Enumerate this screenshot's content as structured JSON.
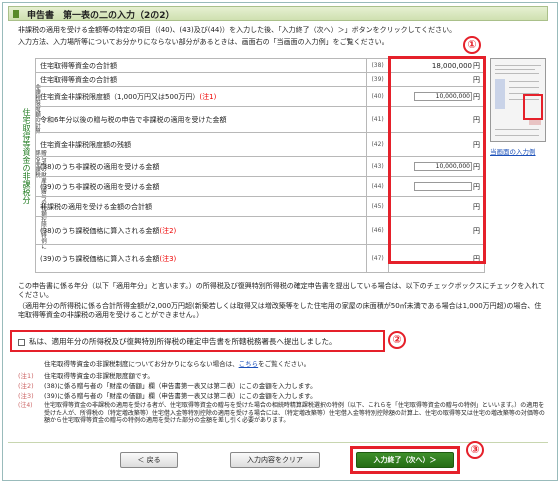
{
  "page": {
    "title": "申告書　第一表の二の入力（2の2）",
    "intro_lines": [
      "非課税の適用を受ける金額等の特定の項目（(40)、(43)及び(44)）を入力した後、「入力終了（次へ）＞」ボタンをクリックしてください。",
      "入力方法、入力場所等についてお分かりにならない部分があるときは、画面右の「当画面の入力例」をご覧ください。"
    ]
  },
  "annotations": [
    "①",
    "②",
    "③"
  ],
  "side_label": "住宅取得等資金の非課税分",
  "side_sublabels": [
    "非課税限度額の計算",
    "贈与者の財産の贈与の税額控除の特例に係る非課税"
  ],
  "rows": [
    {
      "label": "住宅取得等資金の合計額",
      "num": "(38)",
      "value": "18,000,000",
      "unit": "円"
    },
    {
      "label": "住宅取得等資金の合計額",
      "num": "(39)",
      "value": "",
      "unit": "円"
    },
    {
      "label": "住宅資金非課税限度額（1,000万円又は500万円）",
      "note": "(注1)",
      "num": "(40)",
      "input": "10,000,000",
      "unit": "円"
    },
    {
      "label": "令和6年分以後の贈与税の申告で非課税の適用を受けた金額",
      "num": "(41)",
      "value": "",
      "unit": "円"
    },
    {
      "label": "住宅資金非課税限度額の残額",
      "num": "(42)",
      "value": "",
      "unit": "円"
    },
    {
      "label": "(38)のうち非課税の適用を受ける金額",
      "num": "(43)",
      "input": "10,000,000",
      "unit": "円"
    },
    {
      "label": "(39)のうち非課税の適用を受ける金額",
      "num": "(44)",
      "input": "",
      "unit": "円"
    },
    {
      "label": "非課税の適用を受ける金額の合計額",
      "num": "(45)",
      "value": "",
      "unit": "円"
    },
    {
      "label": "(38)のうち課税価格に算入される金額",
      "note": "(注2)",
      "num": "(46)",
      "value": "",
      "unit": "円"
    },
    {
      "label": "(39)のうち課税価格に算入される金額",
      "note": "(注3)",
      "num": "(47)",
      "value": "",
      "unit": "円"
    }
  ],
  "thumb_link": "当画面の入力例",
  "para1": "この申告書に係る年分（以下「適用年分」と言います。）の所得税及び復興特別所得税の確定申告書を提出している場合は、以下のチェックボックスにチェックを入れてください。",
  "para2": "（適用年分の所得税に係る合計所得金額が2,000万円超(新築若しくは取得又は増改築等をした住宅用の家屋の床面積が50㎡未満である場合は1,000万円超)の場合、住宅取得等資金の非課税の適用を受けることができません。）",
  "checkbox_label": "私は、適用年分の所得税及び復興特別所得税の確定申告書を所轄税務署長へ提出しました。",
  "notes": [
    {
      "key": "",
      "text": "住宅取得等資金の非課税制度についてお分かりにならない場合は、",
      "link": "こちら",
      "tail": "をご覧ください。"
    },
    {
      "key": "(注1)",
      "text": "住宅取得等資金の非課税限度額です。"
    },
    {
      "key": "(注2)",
      "text": "(38)に係る贈与者の「財産の価額」欄（申告書第一表又は第二表）にこの金額を入力します。"
    },
    {
      "key": "(注3)",
      "text": "(39)に係る贈与者の「財産の価額」欄（申告書第一表又は第二表）にこの金額を入力します。"
    },
    {
      "key": "(注4)",
      "text": "住宅取得等資金の非課税の適用を受ける者が、住宅取得等資金の贈与を受けた場合の相続時精算課税選択の特例（以下、これらを「住宅取得等資金の贈与の特例」といいます。）の適用を受けた人が、所得税の（特定増改築等）住宅借入金等特別控除の適用を受ける場合には、（特定増改築等）住宅借入金等特別控除額の計算上、住宅の取得等又は住宅の増改築等の対価等の額から住宅取得等資金の贈与の特例の適用を受けた部分の金額を差し引く必要があります。"
    }
  ],
  "buttons": {
    "back": "＜ 戻る",
    "clear": "入力内容をクリア",
    "next": "入力終了（次へ）＞"
  }
}
